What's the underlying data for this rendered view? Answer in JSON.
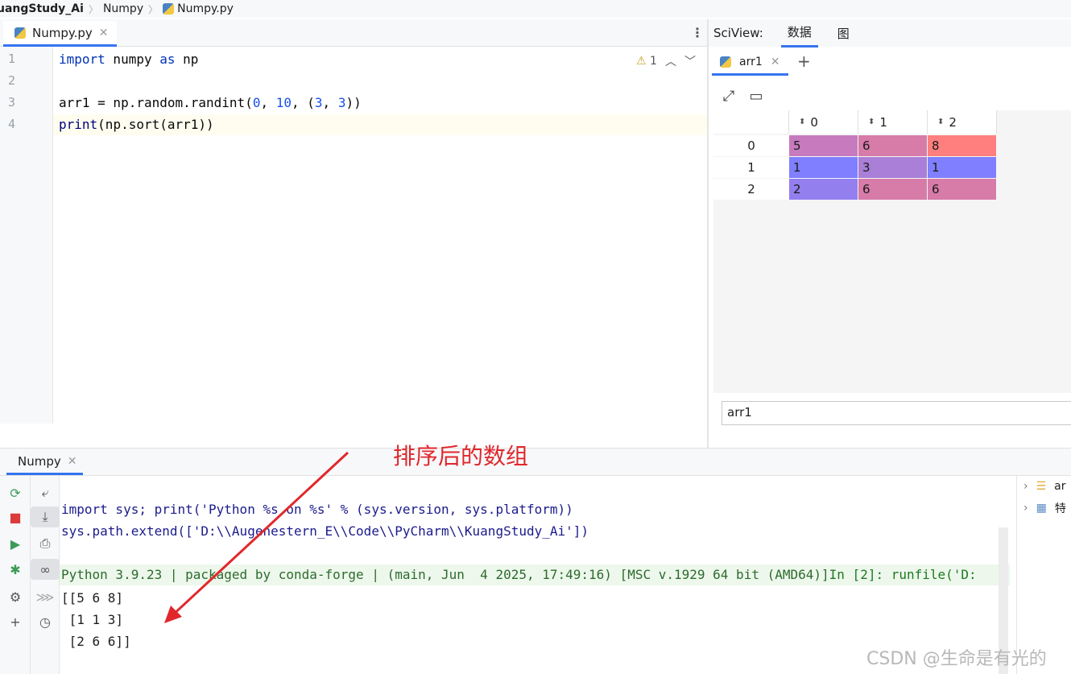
{
  "breadcrumb": {
    "project": "uangStudy_Ai",
    "folder": "Numpy",
    "file": "Numpy.py"
  },
  "editor": {
    "tab_label": "Numpy.py",
    "warning_count": "1",
    "line_numbers": [
      "1",
      "2",
      "3",
      "4"
    ],
    "code": {
      "l1_kw1": "import",
      "l1_mid": " numpy ",
      "l1_kw2": "as",
      "l1_end": " np",
      "l3_a": "arr1 = np.random.randint(",
      "l3_n1": "0",
      "l3_b": ", ",
      "l3_n2": "10",
      "l3_c": ", (",
      "l3_n3": "3",
      "l3_d": ", ",
      "l3_n4": "3",
      "l3_e": "))",
      "l4_fn": "print",
      "l4_rest": "(np.sort(arr1))"
    }
  },
  "sciview": {
    "label": "SciView:",
    "tab_data": "数据",
    "tab_plot": "图",
    "var_tab": "arr1",
    "column_headers": [
      "0",
      "1",
      "2"
    ],
    "row_headers": [
      "0",
      "1",
      "2"
    ],
    "rows": [
      [
        "5",
        "6",
        "8"
      ],
      [
        "1",
        "3",
        "1"
      ],
      [
        "2",
        "6",
        "6"
      ]
    ],
    "cell_colors": [
      [
        "#c77bbe",
        "#d77ba9",
        "#ff7f7f"
      ],
      [
        "#7f7fff",
        "#a97fd7",
        "#7f7fff"
      ],
      [
        "#947fef",
        "#d77ba9",
        "#d77ba9"
      ]
    ],
    "input_value": "arr1"
  },
  "run": {
    "tab_label": "Numpy",
    "console_lines": [
      "import sys; print('Python %s on %s' % (sys.version, sys.platform))",
      "sys.path.extend(['D:\\\\Augenestern_E\\\\Code\\\\PyCharm\\\\KuangStudy_Ai'])",
      "",
      "Python 3.9.23 | packaged by conda-forge | (main, Jun  4 2025, 17:49:16) [MSC v.1929 64 bit (AMD64)]",
      "[[5 6 8]",
      " [1 1 3]",
      " [2 6 6]]"
    ],
    "prompt": "In [2]: runfile('D:",
    "right_items": [
      "ar",
      "特"
    ]
  },
  "annotation": "排序后的数组",
  "watermark": "CSDN @生命是有光的"
}
